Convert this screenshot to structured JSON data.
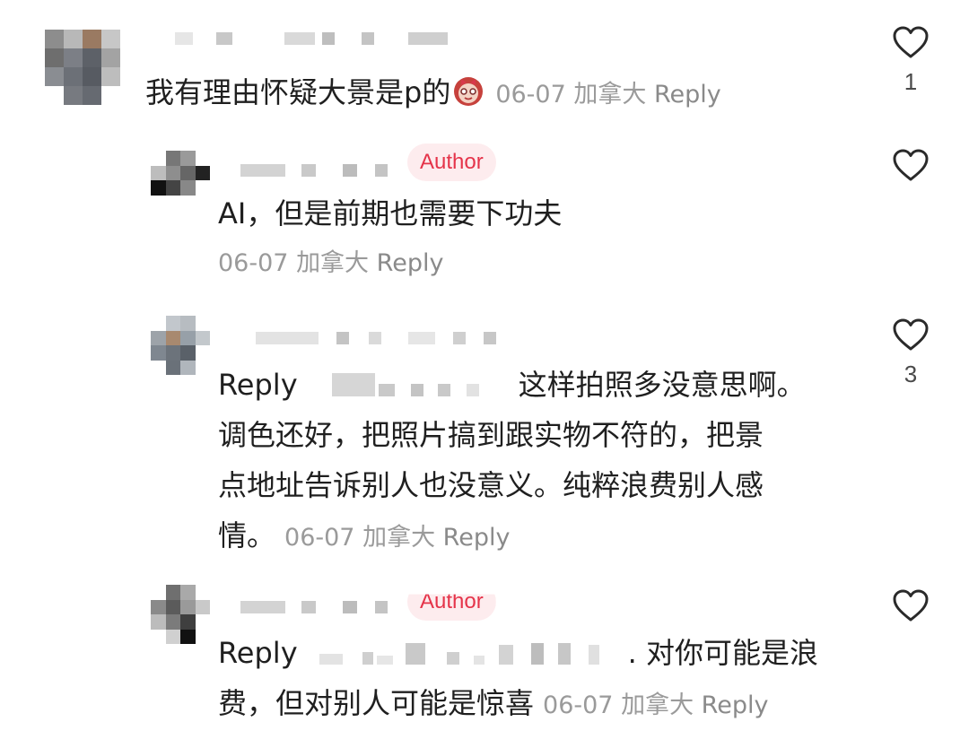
{
  "comments": [
    {
      "text": "我有理由怀疑大景是p的",
      "emoji": "girl-face-emoji",
      "date": "06-07",
      "location": "加拿大",
      "reply_label": "Reply",
      "likes": "1"
    },
    {
      "badge": "Author",
      "text": "AI，但是前期也需要下功夫",
      "date": "06-07",
      "location": "加拿大",
      "reply_label": "Reply",
      "likes": ""
    },
    {
      "reply_prefix": "Reply",
      "line1": "这样拍照多没意思啊。",
      "line2": "调色还好，把照片搞到跟实物不符的，把景",
      "line3": "点地址告诉别人也没意义。纯粹浪费别人感",
      "line4": "情。",
      "date": "06-07",
      "location": "加拿大",
      "reply_label": "Reply",
      "likes": "3"
    },
    {
      "badge": "Author",
      "reply_prefix": "Reply",
      "line1": ". 对你可能是浪",
      "line2": "费，但对别人可能是惊喜",
      "date": "06-07",
      "location": "加拿大",
      "reply_label": "Reply",
      "likes": ""
    }
  ],
  "icons": {
    "like": "heart-outline-icon"
  },
  "colors": {
    "author_badge_bg": "#fdecee",
    "author_badge_text": "#e5344a",
    "meta_text": "#9a9a9a"
  }
}
